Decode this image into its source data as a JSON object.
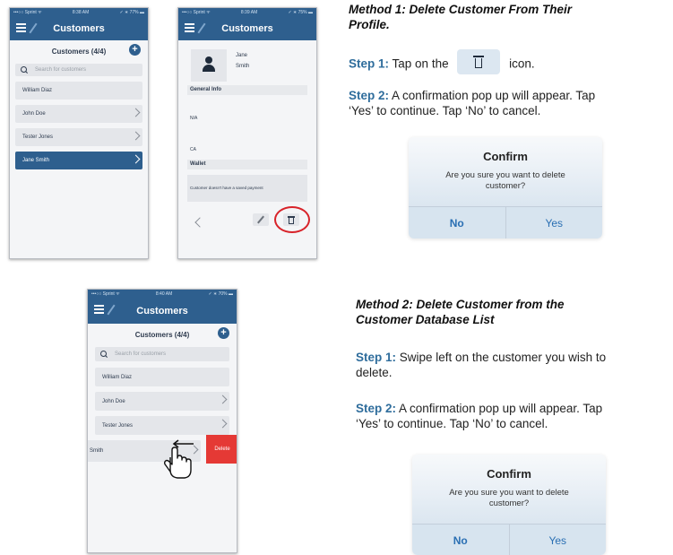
{
  "app": {
    "nav_title": "Customers",
    "list_header": "Customers (4/4)",
    "search_placeholder": "Search for customers",
    "customers": [
      "William Diaz",
      "John Doe",
      "Tester Jones",
      "Jane Smith"
    ],
    "status_phone1": {
      "carrier": "•••○○ Sprint ᯤ",
      "time": "8:38 AM",
      "battery": "✓ ∗ 77% ▬"
    },
    "status_phone2": {
      "carrier": "•••○○ Sprint ᯤ",
      "time": "8:39 AM",
      "battery": "✓ ∗ 75% ▬"
    },
    "status_phone3": {
      "carrier": "•••○○ Sprint ᯤ",
      "time": "8:40 AM",
      "battery": "✓ ∗ 70% ▬"
    },
    "profile": {
      "first_name": "Jane",
      "last_name": "Smith",
      "general_info": "General Info",
      "field_1": "N/A",
      "field_2": "CA",
      "wallet": "Wallet",
      "wallet_message": "Customer doesn't have a saved payment"
    },
    "swipe_row_text": "Smith",
    "delete_label": "Delete"
  },
  "method1": {
    "title_line1": "Method 1: Delete Customer From Their",
    "title_line2": "Profile.",
    "step1_label": "Step 1:",
    "step1_before": "Tap on the",
    "step1_after": "icon.",
    "step2_label": "Step 2:",
    "step2_line1": "A confirmation pop up will appear. Tap",
    "step2_line2": "‘Yes’ to continue. Tap ‘No’ to cancel."
  },
  "method2": {
    "title_line1": "Method 2: Delete Customer from the",
    "title_line2": "Customer Database List",
    "step1_label": "Step 1:",
    "step1_line1": "Swipe left on the customer you wish to",
    "step1_line2": "delete.",
    "step2_label": "Step 2:",
    "step2_line1": "A confirmation pop up will appear. Tap",
    "step2_line2": "‘Yes’ to continue. Tap ‘No’ to cancel."
  },
  "dialog": {
    "title": "Confirm",
    "message": "Are you sure you want to delete customer?",
    "no_label": "No",
    "yes_label": "Yes"
  },
  "colors": {
    "nav_blue": "#2e5f8e",
    "step_label_blue": "#2f6d9c",
    "delete_red": "#e53935",
    "highlight_red": "#d8232a",
    "dialog_button_blue": "#2a6fb3"
  }
}
